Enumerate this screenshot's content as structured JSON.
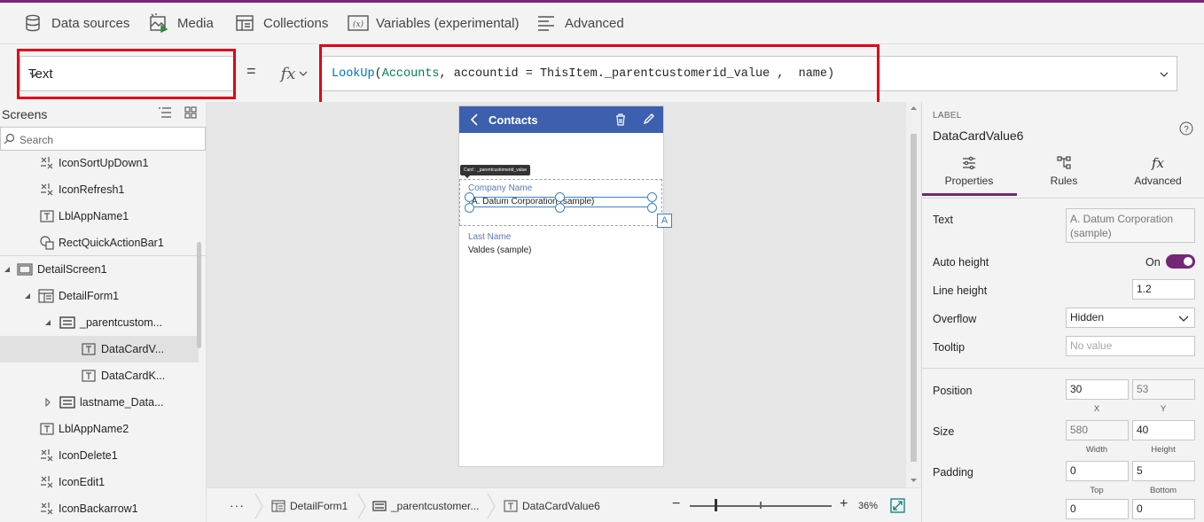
{
  "colors": {
    "accent": "#742774",
    "highlight": "#e0001b",
    "app_header": "#3c5fae",
    "selection": "#3b83c4"
  },
  "toolbar": {
    "items": [
      {
        "label": "Data sources",
        "icon": "database-icon"
      },
      {
        "label": "Media",
        "icon": "media-icon"
      },
      {
        "label": "Collections",
        "icon": "collections-icon"
      },
      {
        "label": "Variables (experimental)",
        "icon": "variables-icon"
      },
      {
        "label": "Advanced",
        "icon": "advanced-icon"
      }
    ]
  },
  "formula_bar": {
    "property": "Text",
    "equals": "=",
    "fx": "fx",
    "formula_fn": "LookUp",
    "formula_open": "(",
    "formula_table": "Accounts",
    "formula_rest": ", accountid = ThisItem._parentcustomerid_value ,  name)"
  },
  "tree": {
    "title": "Screens",
    "search_placeholder": "Search",
    "items": [
      {
        "label": "IconSortUpDown1",
        "icon": "icon-control-icon"
      },
      {
        "label": "IconRefresh1",
        "icon": "icon-control-icon"
      },
      {
        "label": "LblAppName1",
        "icon": "label-icon"
      },
      {
        "label": "RectQuickActionBar1",
        "icon": "rectangle-icon"
      },
      {
        "label": "DetailScreen1",
        "icon": "screen-icon"
      },
      {
        "label": "DetailForm1",
        "icon": "form-icon"
      },
      {
        "label": "_parentcustom...",
        "icon": "card-icon"
      },
      {
        "label": "DataCardV...",
        "icon": "label-icon"
      },
      {
        "label": "DataCardK...",
        "icon": "label-icon"
      },
      {
        "label": "lastname_Data...",
        "icon": "card-icon"
      },
      {
        "label": "LblAppName2",
        "icon": "label-icon"
      },
      {
        "label": "IconDelete1",
        "icon": "icon-control-icon"
      },
      {
        "label": "IconEdit1",
        "icon": "icon-control-icon"
      },
      {
        "label": "IconBackarrow1",
        "icon": "icon-control-icon"
      }
    ]
  },
  "canvas": {
    "screen_title": "Contacts",
    "card_tag": "Card : _parentcustomerid_value",
    "fields": [
      {
        "label": "Company Name",
        "value": "A. Datum Corporation (sample)"
      },
      {
        "label": "Last Name",
        "value": "Valdes (sample)"
      }
    ],
    "badge": "A"
  },
  "breadcrumb": {
    "more": "···",
    "items": [
      "DetailForm1",
      "_parentcustomer...",
      "DataCardValue6"
    ]
  },
  "zoom": {
    "minus": "−",
    "plus": "+",
    "value": "36%",
    "level_percent": 36
  },
  "properties": {
    "control_type": "LABEL",
    "control_name": "DataCardValue6",
    "tabs": [
      "Properties",
      "Rules",
      "Advanced"
    ],
    "active_tab": 0,
    "text_label": "Text",
    "text_value": "A. Datum Corporation (sample)",
    "auto_height_label": "Auto height",
    "auto_height_state": "On",
    "line_height_label": "Line height",
    "line_height_value": "1.2",
    "overflow_label": "Overflow",
    "overflow_value": "Hidden",
    "tooltip_label": "Tooltip",
    "tooltip_placeholder": "No value",
    "position_label": "Position",
    "position_x": "30",
    "position_y": "53",
    "x_label": "X",
    "y_label": "Y",
    "size_label": "Size",
    "size_width": "580",
    "size_height": "40",
    "width_label": "Width",
    "height_label": "Height",
    "padding_label": "Padding",
    "padding_top": "0",
    "padding_bottom": "5",
    "top_label": "Top",
    "bottom_label": "Bottom",
    "padding_left": "0",
    "padding_right": "0"
  }
}
